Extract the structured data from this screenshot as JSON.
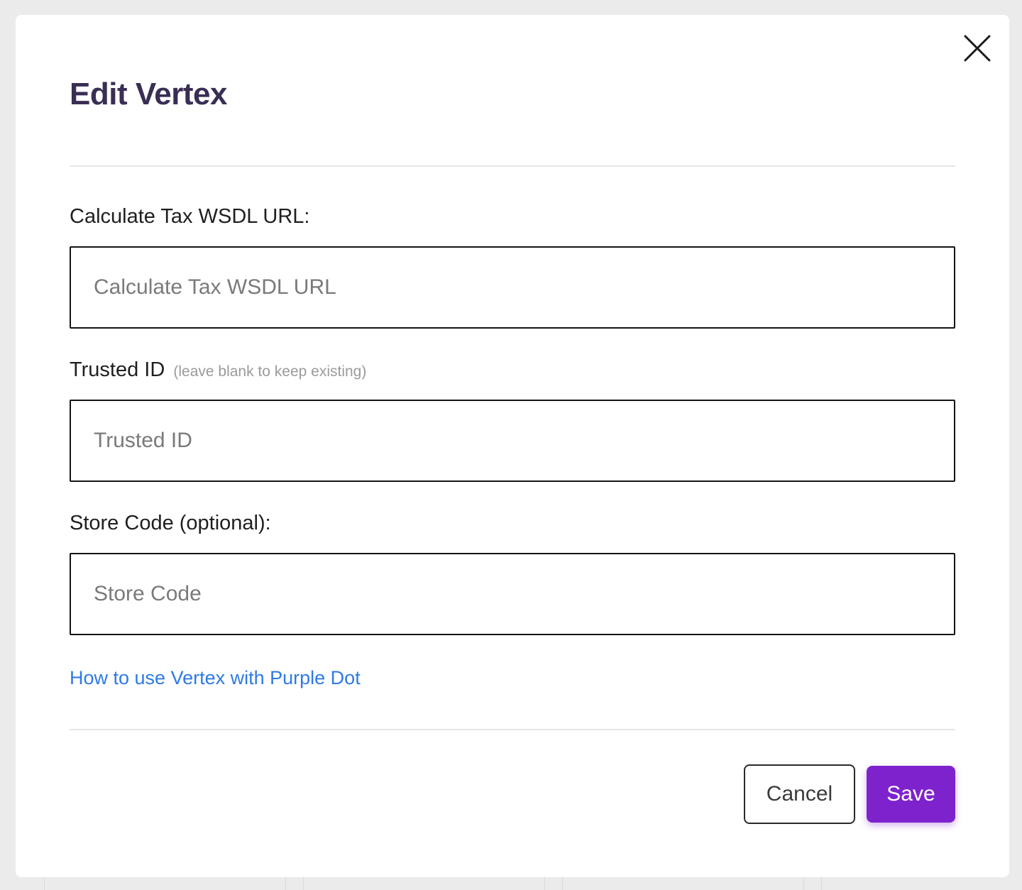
{
  "dialog": {
    "title": "Edit Vertex",
    "close_label": "Close"
  },
  "fields": {
    "wsdl_url": {
      "label": "Calculate Tax WSDL URL:",
      "placeholder": "Calculate Tax WSDL URL",
      "value": ""
    },
    "trusted_id": {
      "label": "Trusted ID",
      "hint": "(leave blank to keep existing)",
      "placeholder": "Trusted ID",
      "value": ""
    },
    "store_code": {
      "label": "Store Code (optional):",
      "placeholder": "Store Code",
      "value": ""
    }
  },
  "help_link": {
    "label": "How to use Vertex with Purple Dot"
  },
  "footer": {
    "cancel_label": "Cancel",
    "save_label": "Save"
  },
  "colors": {
    "title": "#3a2e55",
    "link": "#2f7ae5",
    "save_button": "#7e22ce",
    "backdrop": "#ebebeb"
  },
  "icons": {
    "close": "close-icon"
  }
}
